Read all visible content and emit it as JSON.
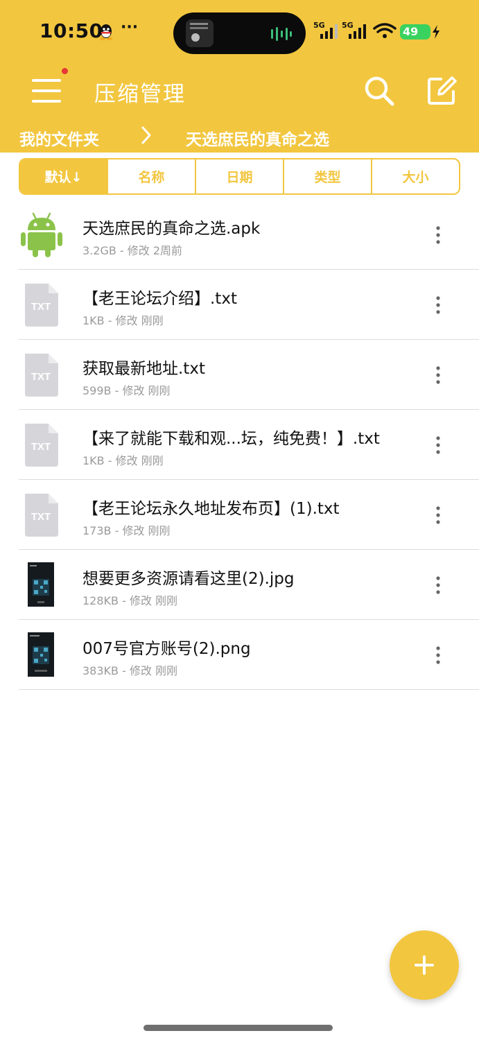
{
  "status_bar": {
    "time": "10:50",
    "more": "···",
    "signal_1_label": "5G",
    "signal_2_label": "5G",
    "battery": "49",
    "icons": [
      "qq-icon",
      "wifi-icon",
      "battery-bolt-icon"
    ]
  },
  "toolbar": {
    "title": "压缩管理",
    "icons": [
      "menu-icon",
      "search-icon",
      "edit-icon"
    ]
  },
  "breadcrumb": {
    "root": "我的文件夹",
    "separator_icon": "chevron-right-icon",
    "current": "天选庶民的真命之选"
  },
  "sort_tabs": [
    {
      "label": "默认↓",
      "active": true
    },
    {
      "label": "名称",
      "active": false
    },
    {
      "label": "日期",
      "active": false
    },
    {
      "label": "类型",
      "active": false
    },
    {
      "label": "大小",
      "active": false
    }
  ],
  "files": [
    {
      "name": "天选庶民的真命之选.apk",
      "meta": "3.2GB - 修改 2周前",
      "icon": "android-icon"
    },
    {
      "name": "【老王论坛介绍】.txt",
      "meta": "1KB - 修改 刚刚",
      "icon": "txt-file-icon",
      "icon_text": "TXT"
    },
    {
      "name": "获取最新地址.txt",
      "meta": "599B - 修改 刚刚",
      "icon": "txt-file-icon",
      "icon_text": "TXT"
    },
    {
      "name": "【来了就能下载和观...坛，纯免费！】.txt",
      "meta": "1KB - 修改 刚刚",
      "icon": "txt-file-icon",
      "icon_text": "TXT"
    },
    {
      "name": "【老王论坛永久地址发布页】(1).txt",
      "meta": "173B - 修改 刚刚",
      "icon": "txt-file-icon",
      "icon_text": "TXT"
    },
    {
      "name": "想要更多资源请看这里(2).jpg",
      "meta": "128KB - 修改 刚刚",
      "icon": "image-thumbnail"
    },
    {
      "name": "007号官方账号(2).png",
      "meta": "383KB - 修改 刚刚",
      "icon": "image-thumbnail"
    }
  ],
  "fab": {
    "icon": "plus-icon"
  },
  "colors": {
    "accent": "#f2c63f",
    "header_text": "#ffffff",
    "meta_text": "#9a9a9a",
    "android_green": "#8bc34a",
    "badge_red": "#e53935"
  }
}
